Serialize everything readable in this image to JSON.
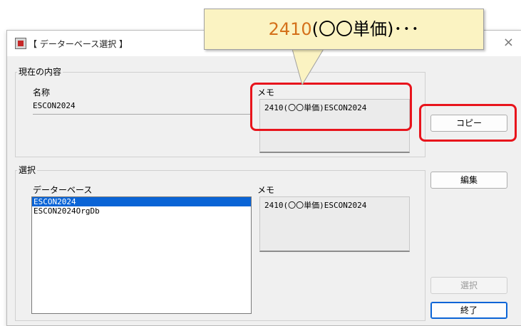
{
  "dialog": {
    "title": "【 データーベース選択 】",
    "close_glyph": "×"
  },
  "current": {
    "group_label": "現在の内容",
    "name_label": "名称",
    "name_value": "ESCON2024",
    "memo_label": "メモ",
    "memo_value": "2410(〇〇単価)ESCON2024"
  },
  "select": {
    "group_label": "選択",
    "database_label": "データーベース",
    "databases": [
      "ESCON2024",
      "ESCON2024OrgDb"
    ],
    "selected_index": 0,
    "memo_label": "メモ",
    "memo_value": "2410(〇〇単価)ESCON2024"
  },
  "buttons": {
    "copy": "コピー",
    "edit": "編集",
    "select": "選択",
    "exit": "終了"
  },
  "callout": {
    "code": "2410",
    "text": "(〇〇単価)･･･",
    "code_color": "#d4711b"
  },
  "highlight_color": "#e8141c"
}
